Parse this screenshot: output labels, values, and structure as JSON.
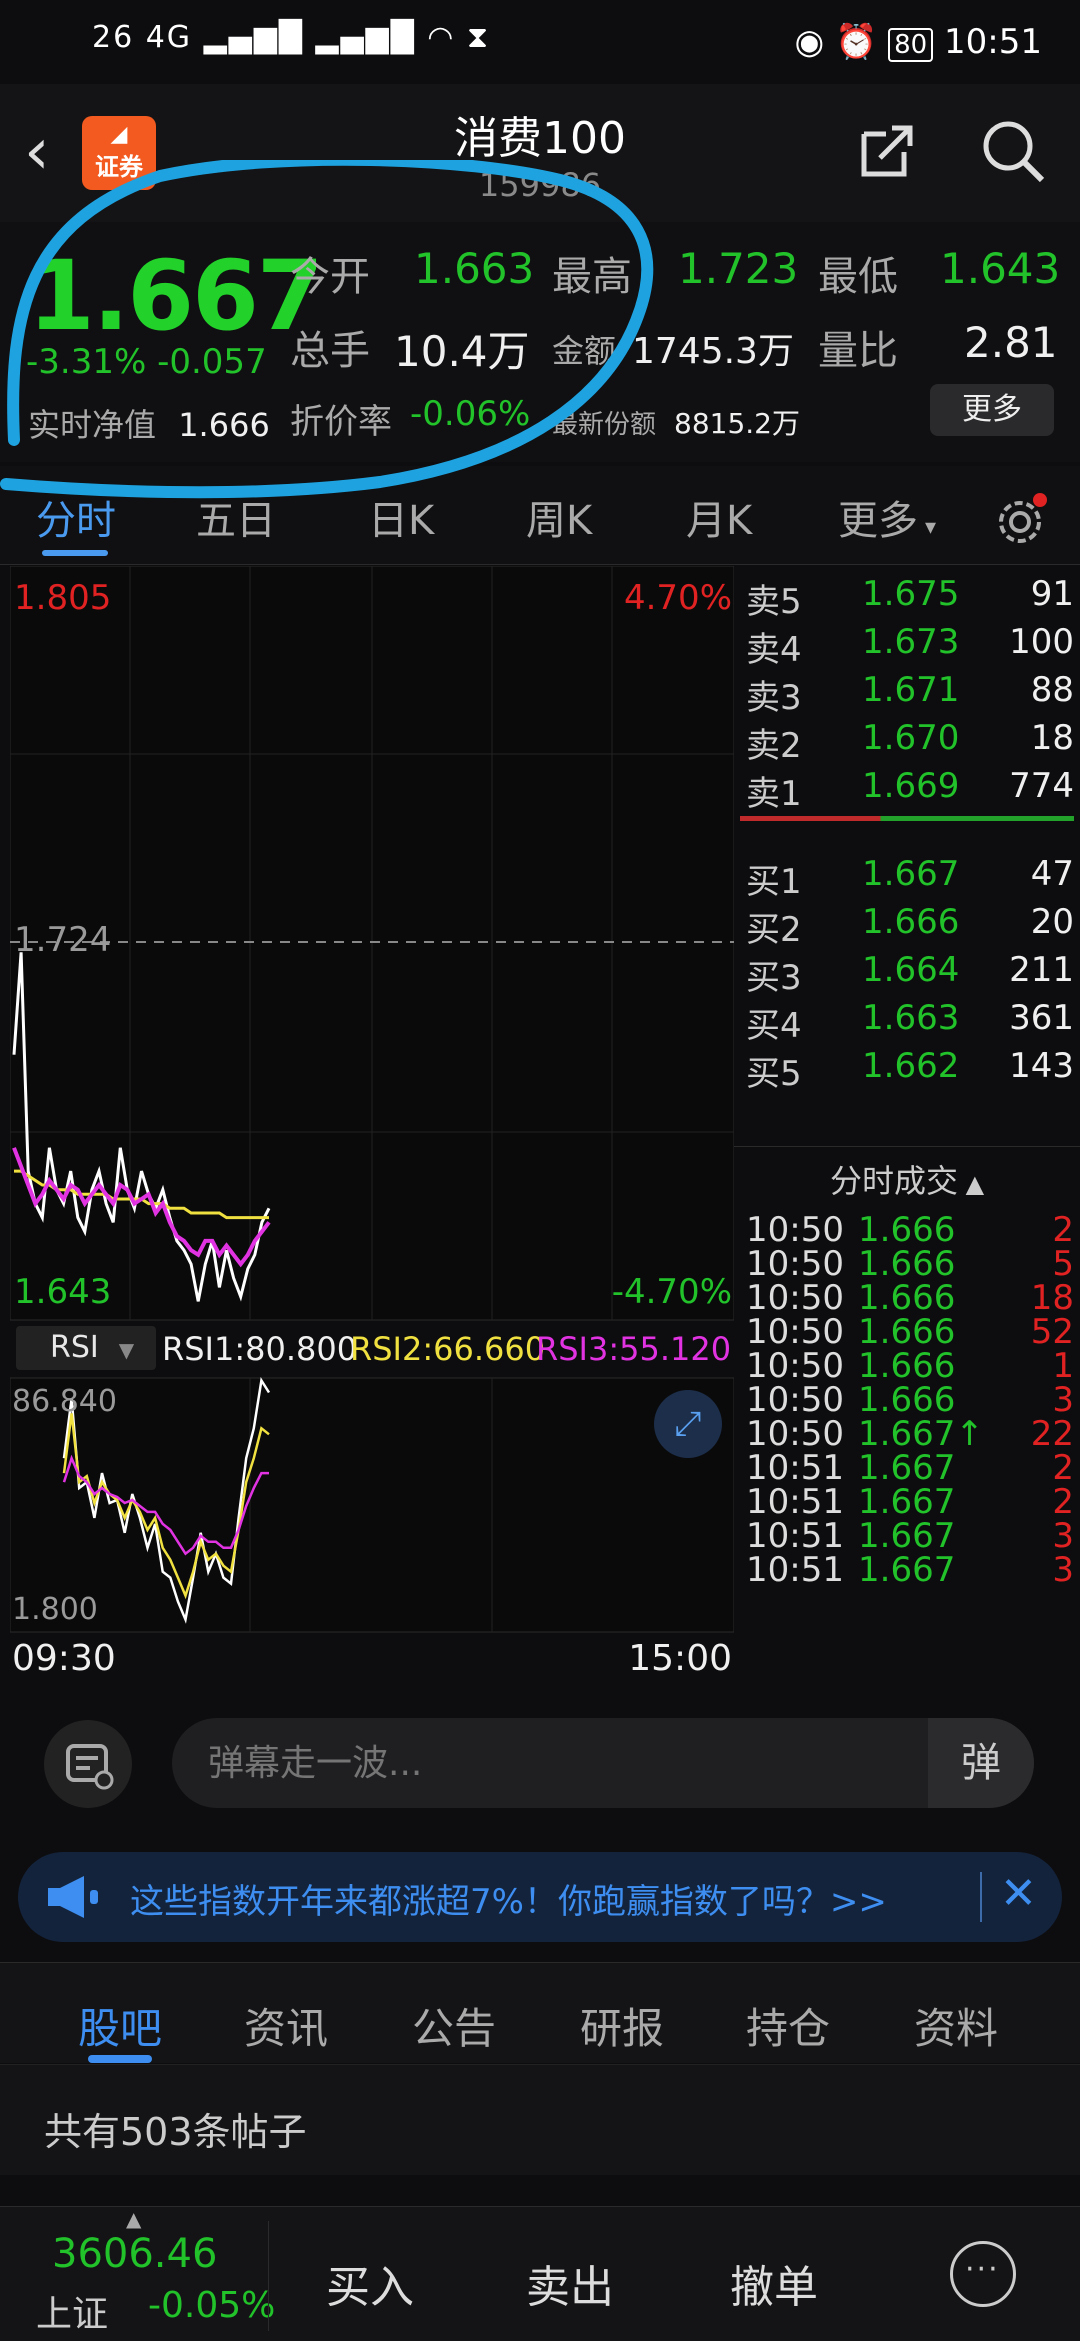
{
  "status_bar": {
    "left": "26 4G",
    "battery": "80",
    "time": "10:51"
  },
  "header": {
    "logo_text": "证券",
    "title": "消费100",
    "code": "159986"
  },
  "quote": {
    "price": "1.667",
    "change_pct": "-3.31%",
    "change_abs": "-0.057",
    "nav_label": "实时净值",
    "nav_value": "1.666",
    "open_label": "今开",
    "open_value": "1.663",
    "high_label": "最高",
    "high_value": "1.723",
    "low_label": "最低",
    "low_value": "1.643",
    "volume_label": "总手",
    "volume_value": "10.4万",
    "amount_label": "金额",
    "amount_value": "1745.3万",
    "ratio_label": "量比",
    "ratio_value": "2.81",
    "discount_label": "折价率",
    "discount_value": "-0.06%",
    "latest_share_label": "最新份额",
    "latest_share_value": "8815.2万",
    "more_button": "更多"
  },
  "chart_tabs": {
    "items": [
      "分时",
      "五日",
      "日K",
      "周K",
      "月K",
      "更多"
    ],
    "active": 0
  },
  "intraday_chart": {
    "y_top": "1.805",
    "y_mid": "1.724",
    "y_bottom": "1.643",
    "pct_top": "4.70%",
    "pct_bottom": "-4.70%",
    "time_start": "09:30",
    "time_end": "15:00"
  },
  "rsi_panel": {
    "selector": "RSI",
    "rsi1": "RSI1:80.800",
    "rsi2": "RSI2:66.660",
    "rsi3": "RSI3:55.120",
    "y_top": "86.840",
    "y_bottom": "1.800"
  },
  "chart_data": {
    "type": "line",
    "title": "",
    "xlabel": "",
    "ylabel": "",
    "ylim": [
      1.643,
      1.805
    ],
    "x_range": [
      "09:30",
      "15:00"
    ],
    "series": [
      {
        "name": "",
        "color": "#ffffff",
        "values": [
          1.7,
          1.722,
          1.675,
          1.668,
          1.665,
          1.68,
          1.671,
          1.668,
          1.675,
          1.665,
          1.662,
          1.671,
          1.675,
          1.668,
          1.664,
          1.68,
          1.671,
          1.667,
          1.675,
          1.67,
          1.667,
          1.671,
          1.665,
          1.66,
          1.658,
          1.655,
          1.647,
          1.655,
          1.66,
          1.65,
          1.658,
          1.652,
          1.648,
          1.654,
          1.657,
          1.664,
          1.667
        ]
      },
      {
        "name": "",
        "color": "#f0e040",
        "values": [
          1.675,
          1.675,
          1.674,
          1.673,
          1.672,
          1.672,
          1.671,
          1.671,
          1.671,
          1.67,
          1.67,
          1.67,
          1.67,
          1.67,
          1.669,
          1.669,
          1.669,
          1.669,
          1.669,
          1.668,
          1.668,
          1.668,
          1.667,
          1.667,
          1.667,
          1.666,
          1.666,
          1.666,
          1.666,
          1.666,
          1.665,
          1.665,
          1.665,
          1.665,
          1.665,
          1.665,
          1.665
        ]
      },
      {
        "name": "",
        "color": "#e233e2",
        "values": [
          1.68,
          1.676,
          1.672,
          1.668,
          1.67,
          1.673,
          1.671,
          1.669,
          1.672,
          1.671,
          1.668,
          1.67,
          1.672,
          1.67,
          1.668,
          1.672,
          1.671,
          1.668,
          1.669,
          1.67,
          1.666,
          1.668,
          1.664,
          1.661,
          1.66,
          1.658,
          1.657,
          1.66,
          1.66,
          1.657,
          1.659,
          1.657,
          1.655,
          1.657,
          1.66,
          1.662,
          1.664
        ]
      }
    ]
  },
  "rsi_chart_data": {
    "type": "line",
    "title": "",
    "xlabel": "",
    "ylabel": "",
    "ylim": [
      1.8,
      86.84
    ],
    "series": [
      {
        "name": "RSI1",
        "color": "#ffffff",
        "values": [
          60,
          80,
          50,
          52,
          40,
          55,
          45,
          46,
          35,
          48,
          40,
          30,
          38,
          22,
          20,
          12,
          6,
          20,
          35,
          22,
          28,
          20,
          18,
          40,
          60,
          70,
          86,
          82
        ]
      },
      {
        "name": "RSI2",
        "color": "#f0e040",
        "values": [
          55,
          75,
          52,
          54,
          45,
          52,
          48,
          46,
          40,
          46,
          42,
          36,
          40,
          30,
          26,
          20,
          14,
          22,
          32,
          26,
          28,
          24,
          22,
          36,
          52,
          60,
          70,
          68
        ]
      },
      {
        "name": "RSI3",
        "color": "#e233e2",
        "values": [
          52,
          60,
          54,
          52,
          48,
          50,
          48,
          47,
          45,
          46,
          44,
          42,
          42,
          38,
          36,
          32,
          28,
          30,
          34,
          32,
          32,
          30,
          30,
          36,
          44,
          50,
          55,
          55
        ]
      }
    ]
  },
  "orderbook": {
    "asks": [
      {
        "label": "卖5",
        "price": "1.675",
        "volume": "91"
      },
      {
        "label": "卖4",
        "price": "1.673",
        "volume": "100"
      },
      {
        "label": "卖3",
        "price": "1.671",
        "volume": "88"
      },
      {
        "label": "卖2",
        "price": "1.670",
        "volume": "18"
      },
      {
        "label": "卖1",
        "price": "1.669",
        "volume": "774"
      }
    ],
    "bids": [
      {
        "label": "买1",
        "price": "1.667",
        "volume": "47"
      },
      {
        "label": "买2",
        "price": "1.666",
        "volume": "20"
      },
      {
        "label": "买3",
        "price": "1.664",
        "volume": "211"
      },
      {
        "label": "买4",
        "price": "1.663",
        "volume": "361"
      },
      {
        "label": "买5",
        "price": "1.662",
        "volume": "143"
      }
    ],
    "trades_header": "分时成交",
    "trades": [
      {
        "time": "10:50",
        "price": "1.666",
        "volume": "2"
      },
      {
        "time": "10:50",
        "price": "1.666",
        "volume": "5"
      },
      {
        "time": "10:50",
        "price": "1.666",
        "volume": "18"
      },
      {
        "time": "10:50",
        "price": "1.666",
        "volume": "52"
      },
      {
        "time": "10:50",
        "price": "1.666",
        "volume": "1"
      },
      {
        "time": "10:50",
        "price": "1.666",
        "volume": "3"
      },
      {
        "time": "10:50",
        "price": "1.667↑",
        "volume": "22"
      },
      {
        "time": "10:51",
        "price": "1.667",
        "volume": "2"
      },
      {
        "time": "10:51",
        "price": "1.667",
        "volume": "2"
      },
      {
        "time": "10:51",
        "price": "1.667",
        "volume": "3"
      },
      {
        "time": "10:51",
        "price": "1.667",
        "volume": "3"
      }
    ]
  },
  "danmu": {
    "placeholder": "弹幕走一波...",
    "send_label": "弹"
  },
  "banner": {
    "text": "这些指数开年来都涨超7%！你跑赢指数了吗？>>"
  },
  "bottom_tabs": {
    "items": [
      "股吧",
      "资讯",
      "公告",
      "研报",
      "持仓",
      "资料"
    ],
    "active": 0
  },
  "posts": {
    "count_text": "共有503条帖子"
  },
  "bottom_bar": {
    "index_value": "3606.46",
    "index_name": "上证",
    "index_change": "-0.05%",
    "buy": "买入",
    "sell": "卖出",
    "cancel": "撤单"
  },
  "colors": {
    "down": "#22c32a",
    "up": "#e02222",
    "accent": "#3d8ef0",
    "annotation": "#1ea3e0"
  }
}
